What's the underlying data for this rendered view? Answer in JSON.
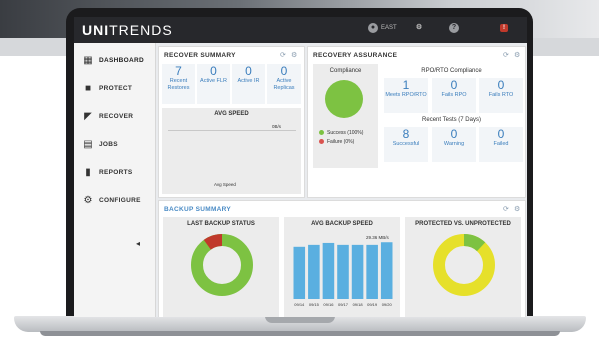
{
  "app": {
    "brand_bold": "UNI",
    "brand_light": "TRENDS",
    "user_label": "EAST"
  },
  "sidebar": {
    "items": [
      {
        "label": "DASHBOARD",
        "icon": "dashboard-icon"
      },
      {
        "label": "PROTECT",
        "icon": "lock-icon"
      },
      {
        "label": "RECOVER",
        "icon": "recover-arrow-icon"
      },
      {
        "label": "JOBS",
        "icon": "jobs-icon"
      },
      {
        "label": "REPORTS",
        "icon": "bar-chart-icon"
      },
      {
        "label": "CONFIGURE",
        "icon": "gear-icon"
      }
    ]
  },
  "recover_summary": {
    "title": "RECOVER SUMMARY",
    "metrics": [
      {
        "value": "7",
        "label1": "Recent",
        "label2": "Restores"
      },
      {
        "value": "0",
        "label1": "Active FLR",
        "label2": ""
      },
      {
        "value": "0",
        "label1": "Active IR",
        "label2": ""
      },
      {
        "value": "0",
        "label1": "Active",
        "label2": "Replicas"
      }
    ],
    "avg_speed_title": "AVG SPEED",
    "avg_speed_unit": "0B/s",
    "avg_speed_legend": "Avg Speed"
  },
  "recovery_assurance": {
    "title": "RECOVERY ASSURANCE",
    "compliance_title": "Compliance",
    "legend": [
      {
        "label": "Success (100%)",
        "color": "#7dc242"
      },
      {
        "label": "Failure (0%)",
        "color": "#d9534f"
      }
    ],
    "rpo_title": "RPO/RTO Compliance",
    "rpo_metrics": [
      {
        "value": "1",
        "label": "Meets RPO/RTO"
      },
      {
        "value": "0",
        "label": "Fails RPO"
      },
      {
        "value": "0",
        "label": "Fails RTO"
      }
    ],
    "tests_title": "Recent Tests (7 Days)",
    "tests_metrics": [
      {
        "value": "8",
        "label": "Successful"
      },
      {
        "value": "0",
        "label": "Warning"
      },
      {
        "value": "0",
        "label": "Failed"
      }
    ]
  },
  "backup_summary": {
    "title": "BACKUP SUMMARY",
    "last_status_title": "LAST BACKUP STATUS",
    "avg_backup_title": "AVG BACKUP SPEED",
    "protected_title": "PROTECTED VS. UNPROTECTED",
    "speed_label": "29.36 MB/s",
    "status_split": {
      "success": 0.9,
      "failure": 0.1
    },
    "protected_split": {
      "protected": 0.88,
      "unprotected": 0.12
    }
  },
  "chart_data": {
    "type": "bar",
    "title": "AVG BACKUP SPEED",
    "categories": [
      "09/14",
      "09/15",
      "09/16",
      "09/17",
      "09/18",
      "09/19",
      "09/20"
    ],
    "values": [
      27,
      28,
      29,
      28,
      28,
      28,
      29.36
    ],
    "ylim": [
      0,
      30
    ]
  },
  "colors": {
    "green": "#7dc242",
    "red": "#c0392b",
    "yellow": "#e6e02a",
    "blue": "#5aafe0",
    "accent": "#3a7dbc"
  }
}
